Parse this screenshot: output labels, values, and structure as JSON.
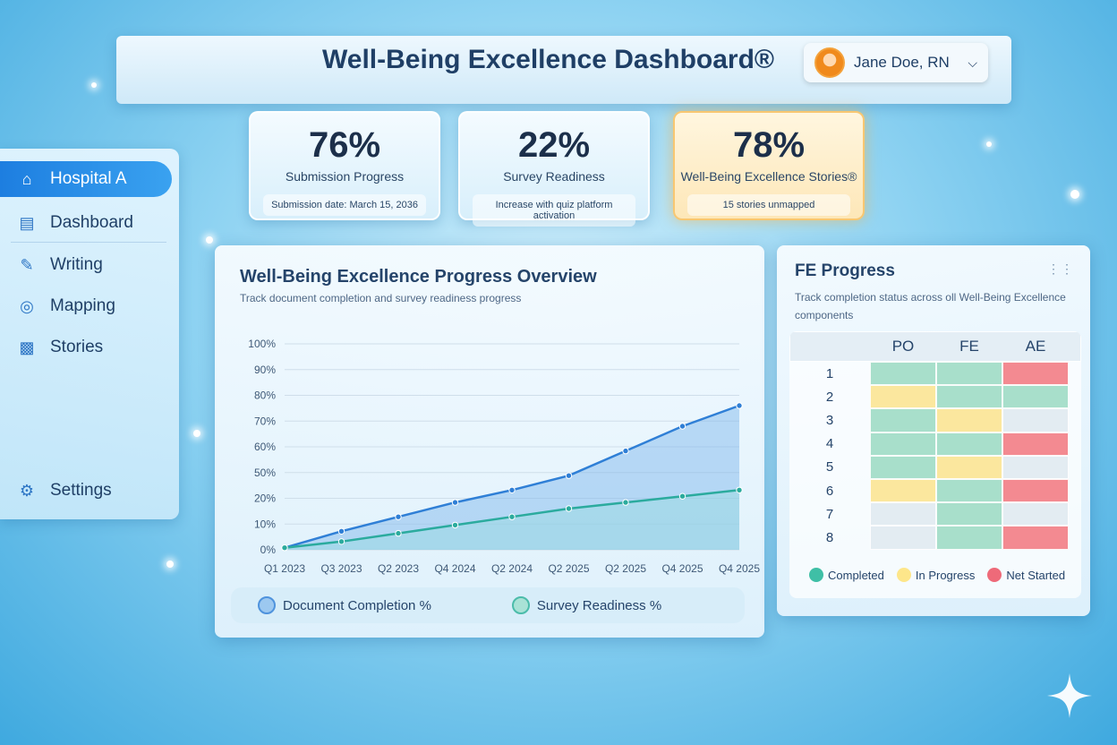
{
  "header": {
    "title": "Well-Being Excellence Dashboard®",
    "user_name": "Jane Doe, RN",
    "user_menu_icon": "chevron-down-icon"
  },
  "kpis": [
    {
      "value": "76%",
      "label": "Submission Progress",
      "sub": "Submission date: March 15, 2036",
      "accent": "#d8effb"
    },
    {
      "value": "22%",
      "label": "Survey Readiness",
      "sub": "Increase with quiz platform activation",
      "accent": "#d8effb"
    },
    {
      "value": "78%",
      "label": "Well-Being Excellence Stories®",
      "sub": "15 stories unmapped",
      "accent": "#fde7b8"
    }
  ],
  "sidebar": {
    "items": [
      {
        "label": "Hospital A",
        "icon": "home-icon"
      },
      {
        "label": "Dashboard",
        "icon": "dashboard-icon"
      },
      {
        "label": "Writing",
        "icon": "writing-icon"
      },
      {
        "label": "Mapping",
        "icon": "mapping-icon"
      },
      {
        "label": "Stories",
        "icon": "stories-icon"
      },
      {
        "label": "Settings",
        "icon": "gear-icon"
      }
    ]
  },
  "progress_panel": {
    "title": "Well-Being Excellence Progress Overview",
    "subtitle": "Track document completion and survey readiness progress",
    "legend": [
      "Document Completion %",
      "Survey Readiness %"
    ]
  },
  "chart_data": {
    "type": "area",
    "categories": [
      "Q1 2023",
      "Q3 2023",
      "Q2 2023",
      "Q4 2024",
      "Q2 2024",
      "Q2 2025",
      "Q2 2025",
      "Q4 2025",
      "Q4 2025"
    ],
    "y_ticks": [
      "0%",
      "10%",
      "20%",
      "50%",
      "60%",
      "70%",
      "80%",
      "90%",
      "100%"
    ],
    "ylim": [
      0,
      100
    ],
    "grid": true,
    "series": [
      {
        "name": "Document Completion %",
        "color": "#2f7fd6",
        "values": [
          1,
          9,
          16,
          23,
          29,
          36,
          48,
          60,
          70
        ]
      },
      {
        "name": "Survey Readiness %",
        "color": "#2bab9e",
        "values": [
          1,
          4,
          8,
          12,
          16,
          20,
          23,
          26,
          29
        ]
      }
    ]
  },
  "fe_panel": {
    "title": "FE Progress",
    "subtitle": "Track completion status across oll Well-Being Excellence components",
    "columns": [
      "PO",
      "FE",
      "AE"
    ],
    "rows": [
      "1",
      "2",
      "3",
      "4",
      "5",
      "6",
      "7",
      "8"
    ],
    "status": [
      [
        "completed",
        "completed",
        "not_started"
      ],
      [
        "in_progress",
        "completed",
        "completed"
      ],
      [
        "completed",
        "in_progress",
        "empty"
      ],
      [
        "completed",
        "completed",
        "not_started"
      ],
      [
        "completed",
        "in_progress",
        "empty"
      ],
      [
        "in_progress",
        "completed",
        "not_started"
      ],
      [
        "empty",
        "completed",
        "empty"
      ],
      [
        "empty",
        "completed",
        "not_started"
      ]
    ],
    "status_colors": {
      "completed": "#a8dfcb",
      "in_progress": "#fbe79e",
      "not_started": "#f38a91",
      "empty": "#e3ecf2"
    },
    "legend": [
      {
        "label": "Completed",
        "color": "#3fbfa6"
      },
      {
        "label": "In Progress",
        "color": "#fde68a"
      },
      {
        "label": "Net Started",
        "color": "#ee6a79"
      }
    ],
    "menu_icon": "grip-dots-icon"
  }
}
